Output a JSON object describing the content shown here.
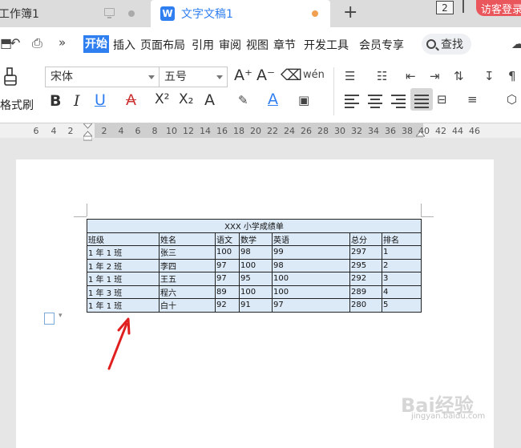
{
  "tabs": {
    "tab1_title": "工作簿1",
    "tab2_logo": "W",
    "tab2_title": "文字文稿1",
    "new_tab": "+",
    "window_count": "2",
    "guest_login": "访客登录"
  },
  "menu": {
    "items": [
      "开始",
      "插入",
      "页面布局",
      "引用",
      "审阅",
      "视图",
      "章节",
      "开发工具",
      "会员专享"
    ],
    "active": "开始",
    "search_label": "查找"
  },
  "ribbon": {
    "format_painter_label": "格式刷",
    "font_name": "宋体",
    "font_size": "五号",
    "bold": "B",
    "italic": "I",
    "underline": "U",
    "strike": "A",
    "superscript": "X²",
    "subscript": "X₂",
    "font_color": "A",
    "text_effect": "A",
    "grow_font": "A⁺",
    "shrink_font": "A⁻",
    "phonetic": "wén"
  },
  "ruler": {
    "ticks": [
      "6",
      "4",
      "2",
      "2",
      "4",
      "6",
      "8",
      "10",
      "12",
      "14",
      "16",
      "18",
      "20",
      "22",
      "24",
      "26",
      "28",
      "30",
      "32",
      "34",
      "36",
      "38",
      "40",
      "42",
      "44",
      "46"
    ]
  },
  "table": {
    "title": "XXX 小学成绩单",
    "headers": [
      "班级",
      "姓名",
      "语文",
      "数学",
      "英语",
      "总分",
      "排名"
    ],
    "rows": [
      [
        "1 年 1 班",
        "张三",
        "100",
        "98",
        "99",
        "297",
        "1"
      ],
      [
        "1 年 2 班",
        "李四",
        "97",
        "100",
        "98",
        "295",
        "2"
      ],
      [
        "1 年 1 班",
        "王五",
        "97",
        "95",
        "100",
        "292",
        "3"
      ],
      [
        "1 年 3 班",
        "程六",
        "89",
        "100",
        "100",
        "289",
        "4"
      ],
      [
        "1 年 1 班",
        "白十",
        "92",
        "91",
        "97",
        "280",
        "5"
      ]
    ]
  },
  "watermark": {
    "brand": "Bai经验",
    "url": "jingyan.baidu.com"
  },
  "colors": {
    "accent_blue": "#2f7ff0",
    "guest_red": "#e9565c",
    "table_fill": "#dce9f6",
    "arrow_red": "#e0201e"
  }
}
